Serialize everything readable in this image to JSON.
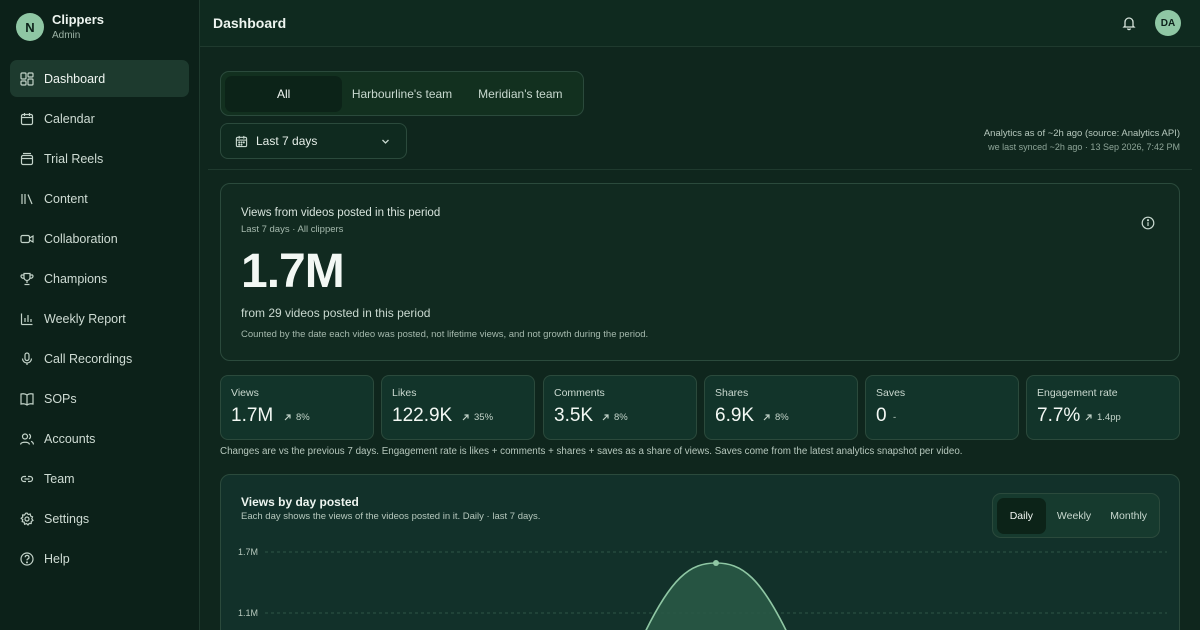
{
  "brand": {
    "initial": "N",
    "name": "Clippers",
    "role": "Admin"
  },
  "sidebar": {
    "items": [
      {
        "label": "Dashboard",
        "icon": "dashboard-icon",
        "active": true
      },
      {
        "label": "Calendar",
        "icon": "calendar-icon"
      },
      {
        "label": "Trial Reels",
        "icon": "reels-icon"
      },
      {
        "label": "Content",
        "icon": "library-icon"
      },
      {
        "label": "Collaboration",
        "icon": "video-icon"
      },
      {
        "label": "Champions",
        "icon": "trophy-icon"
      },
      {
        "label": "Weekly Report",
        "icon": "bar-chart-icon"
      },
      {
        "label": "Call Recordings",
        "icon": "microphone-icon"
      },
      {
        "label": "SOPs",
        "icon": "book-icon"
      },
      {
        "label": "Accounts",
        "icon": "users-icon"
      },
      {
        "label": "Team",
        "icon": "link-icon"
      },
      {
        "label": "Settings",
        "icon": "gear-icon"
      },
      {
        "label": "Help",
        "icon": "help-icon"
      }
    ]
  },
  "header": {
    "title": "Dashboard",
    "user_initials": "DA"
  },
  "team_tabs": [
    "All",
    "Harbourline's team",
    "Meridian's team"
  ],
  "date_range": "Last 7 days",
  "sync": {
    "line1": "Analytics as of ~2h ago (source: Analytics API)",
    "line2": "we last synced ~2h ago · 13 Sep 2026, 7:42 PM"
  },
  "hero": {
    "title": "Views from videos posted in this period",
    "subtitle": "Last 7 days · All clippers",
    "value": "1.7M",
    "count_text": "from 29 videos posted in this period",
    "note": "Counted by the date each video was posted, not lifetime views, and not growth during the period."
  },
  "metrics": [
    {
      "label": "Views",
      "value": "1.7M",
      "delta": "8%"
    },
    {
      "label": "Likes",
      "value": "122.9K",
      "delta": "35%"
    },
    {
      "label": "Comments",
      "value": "3.5K",
      "delta": "8%"
    },
    {
      "label": "Shares",
      "value": "6.9K",
      "delta": "8%"
    },
    {
      "label": "Saves",
      "value": "0",
      "delta": "-"
    },
    {
      "label": "Engagement rate",
      "value": "7.7%",
      "delta": "1.4pp"
    }
  ],
  "metrics_note": "Changes are vs the previous 7 days. Engagement rate is likes + comments + shares + saves as a share of views. Saves come from the latest analytics snapshot per video.",
  "chart": {
    "title": "Views by day posted",
    "subtitle": "Each day shows the views of the videos posted in it. Daily · last 7 days.",
    "period_tabs": [
      "Daily",
      "Weekly",
      "Monthly"
    ],
    "active_period": "Daily"
  },
  "chart_data": {
    "type": "area",
    "y_ticks": [
      "1.7M",
      "1.1M"
    ],
    "peak_value": 1.7
  },
  "colors": {
    "accent": "#8fc7a4",
    "background": "#0f261d"
  }
}
